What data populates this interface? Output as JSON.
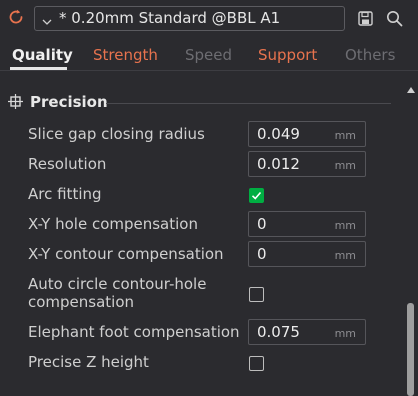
{
  "header": {
    "preset_label": "* 0.20mm Standard @BBL A1",
    "icons": [
      "sync-icon",
      "chevron-down-icon",
      "save-icon",
      "search-icon"
    ]
  },
  "tabs": [
    {
      "label": "Quality",
      "active": true
    },
    {
      "label": "Strength"
    },
    {
      "label": "Speed"
    },
    {
      "label": "Support"
    },
    {
      "label": "Others"
    }
  ],
  "colors": {
    "accent_orange": "#e8734e",
    "check_green": "#00ae42",
    "background": "#2b2b2f"
  },
  "section": {
    "title": "Precision",
    "icon": "precision-icon"
  },
  "settings": {
    "slice_gap": {
      "label": "Slice gap closing radius",
      "value": "0.049",
      "unit": "mm"
    },
    "resolution": {
      "label": "Resolution",
      "value": "0.012",
      "unit": "mm"
    },
    "arc_fitting": {
      "label": "Arc fitting",
      "checked": true
    },
    "xy_hole": {
      "label": "X-Y hole compensation",
      "value": "0",
      "unit": "mm"
    },
    "xy_contour": {
      "label": "X-Y contour compensation",
      "value": "0",
      "unit": "mm"
    },
    "auto_circle": {
      "label_line1": "Auto circle contour-hole",
      "label_line2": "compensation",
      "checked": false
    },
    "elephant_foot": {
      "label": "Elephant foot compensation",
      "value": "0.075",
      "unit": "mm"
    },
    "precise_z": {
      "label": "Precise Z height",
      "checked": false
    }
  }
}
